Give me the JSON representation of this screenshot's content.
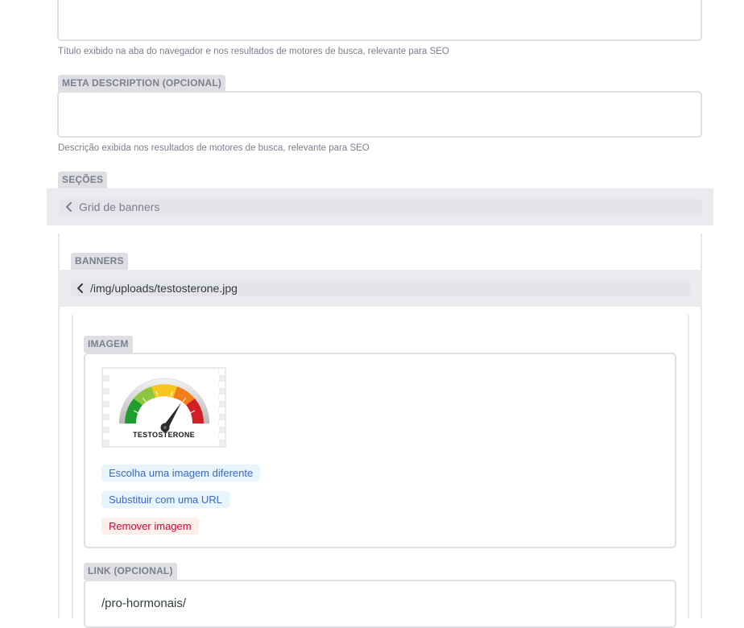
{
  "title_field": {
    "value": "",
    "hint": "Título exibido na aba do navegador e nos resultados de motores de busca, relevante para SEO"
  },
  "meta_description": {
    "label": "META DESCRIPTION (OPCIONAL)",
    "value": "",
    "hint": "Descrição exibida nos resultados de motores de busca, relevante para SEO"
  },
  "sections": {
    "label": "SEÇÕES",
    "item_title": "Grid de banners"
  },
  "banners": {
    "label": "BANNERS",
    "item_title": "/img/uploads/testosterone.jpg"
  },
  "image": {
    "label": "IMAGEM",
    "thumbnail_text": "TESTOSTERONE",
    "choose_button": "Escolha uma imagem diferente",
    "url_button": "Substituir com uma URL",
    "remove_button": "Remover imagem"
  },
  "link": {
    "label": "LINK (OPCIONAL)",
    "value": "/pro-hormonais/"
  },
  "colors": {
    "border": "#dfdfe3",
    "label_bg": "#dfdfe3",
    "label_text": "#7a8090",
    "blue_button_bg": "#e8f5fe",
    "blue_button_text": "#3a69c7",
    "red_button_bg": "#fcefea",
    "red_button_text": "#d60032"
  },
  "icons": {
    "collapse": "chevron-left-icon"
  }
}
